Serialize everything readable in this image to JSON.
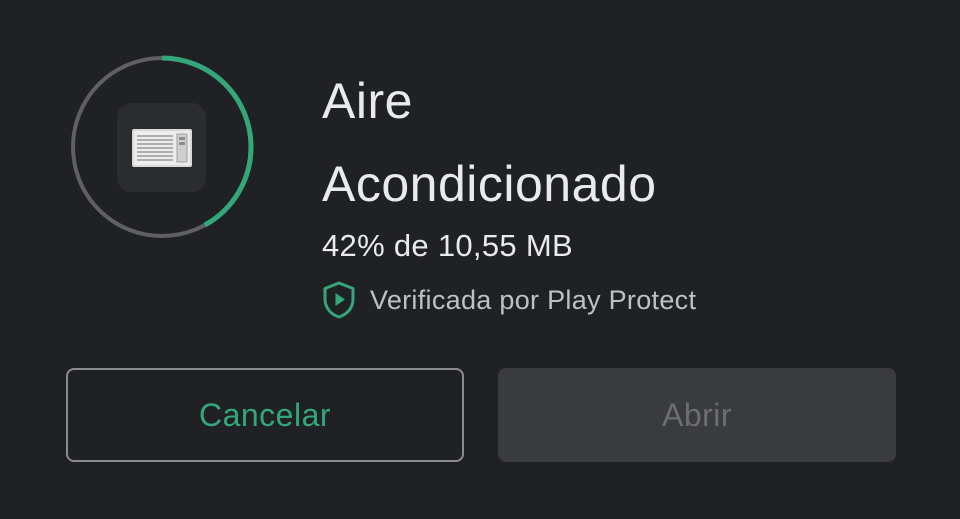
{
  "app": {
    "name_line1": "Aire",
    "name_line2": "Acondicionado",
    "icon": "air-conditioner-icon"
  },
  "download": {
    "progress_fraction": 0.42,
    "status_text": "42% de 10,55 MB"
  },
  "verification": {
    "icon": "play-protect-shield-icon",
    "text": "Verificada por Play Protect"
  },
  "buttons": {
    "cancel_label": "Cancelar",
    "open_label": "Abrir"
  },
  "colors": {
    "background": "#202124",
    "accent_green": "#34a77a",
    "progress_track": "#5f6063",
    "disabled_button_bg": "#3a3b3e",
    "disabled_button_text": "#6b6d70"
  }
}
